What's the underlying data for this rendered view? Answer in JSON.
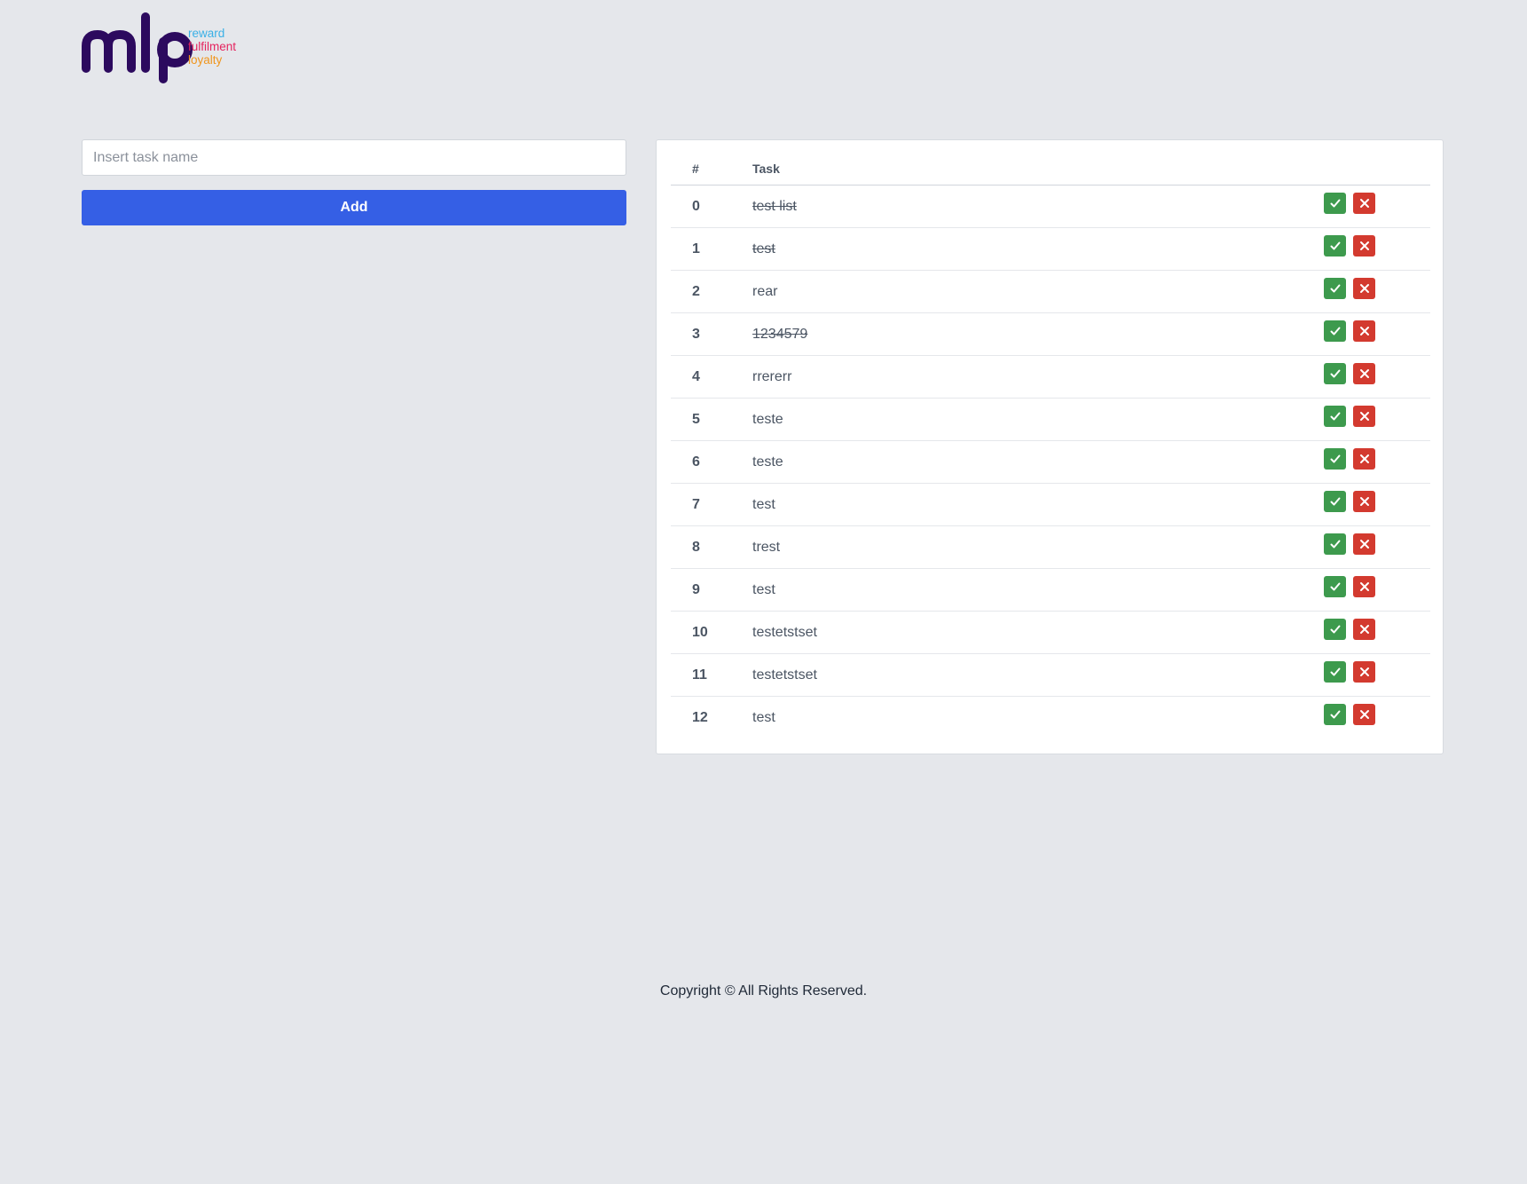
{
  "logo": {
    "wordmark": "mlp",
    "tagline": [
      "reward",
      "fulfilment",
      "loyalty"
    ],
    "colors": {
      "wordmark": "#2c0a5e",
      "reward": "#3ab0e6",
      "fulfilment": "#e5245f",
      "loyalty": "#f0961e"
    }
  },
  "form": {
    "input_placeholder": "Insert task name",
    "input_value": "",
    "add_label": "Add"
  },
  "table": {
    "headers": {
      "index": "#",
      "task": "Task"
    },
    "rows": [
      {
        "index": "0",
        "task": "test list",
        "done": true
      },
      {
        "index": "1",
        "task": "test",
        "done": true
      },
      {
        "index": "2",
        "task": "rear",
        "done": false
      },
      {
        "index": "3",
        "task": "1234579",
        "done": true
      },
      {
        "index": "4",
        "task": "rrererr",
        "done": false
      },
      {
        "index": "5",
        "task": "teste",
        "done": false
      },
      {
        "index": "6",
        "task": "teste",
        "done": false
      },
      {
        "index": "7",
        "task": "test",
        "done": false
      },
      {
        "index": "8",
        "task": "trest",
        "done": false
      },
      {
        "index": "9",
        "task": "test",
        "done": false
      },
      {
        "index": "10",
        "task": "testetstset",
        "done": false
      },
      {
        "index": "11",
        "task": "testetstset",
        "done": false
      },
      {
        "index": "12",
        "task": "test",
        "done": false
      }
    ],
    "actions": {
      "complete_icon": "check-icon",
      "delete_icon": "close-icon"
    }
  },
  "footer": {
    "text": "Copyright © All Rights Reserved."
  },
  "colors": {
    "background": "#e5e7eb",
    "primary": "#355fe5",
    "success": "#3d9a4d",
    "danger": "#d33a2f"
  }
}
